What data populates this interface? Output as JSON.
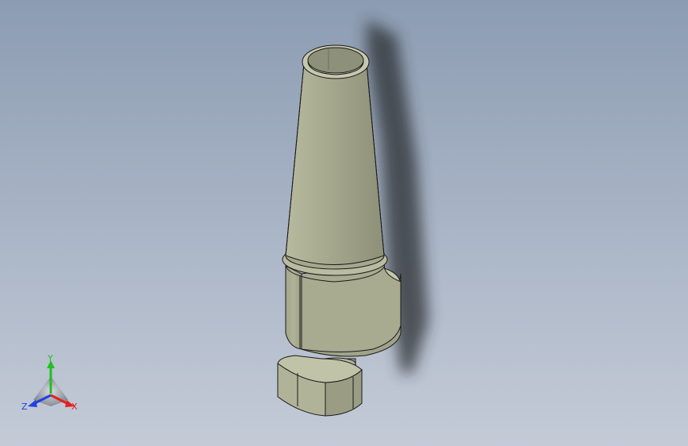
{
  "viewport": {
    "background_top": "#8c9cb2",
    "background_bottom": "#c4cbd7",
    "model_color": "#a8ab90",
    "model_dark": "#7e8169",
    "model_light": "#c5c8ad",
    "edge_color": "#1a1a1a"
  },
  "triad": {
    "x_label": "X",
    "y_label": "Y",
    "z_label": "Z",
    "x_color": "#e02020",
    "y_color": "#20c020",
    "z_color": "#2040e0"
  }
}
